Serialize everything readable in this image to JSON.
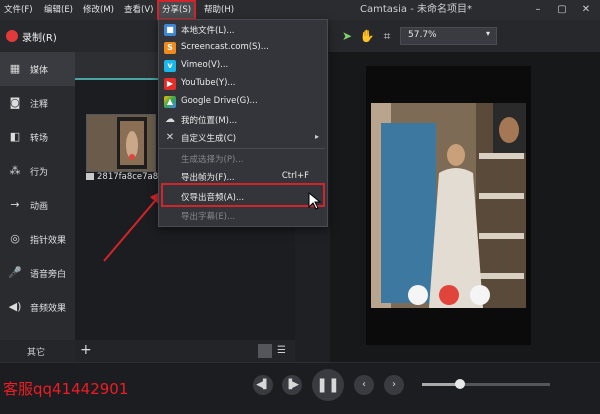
{
  "menubar": {
    "items": [
      "文件(F)",
      "编辑(E)",
      "修改(M)",
      "查看(V)",
      "分享(S)",
      "帮助(H)"
    ],
    "title": "Camtasia - 未命名项目*"
  },
  "toolbar": {
    "record_label": "录制(R)",
    "zoom_value": "57.7%"
  },
  "sidebar": {
    "items": [
      {
        "label": "媒体",
        "icon": "film-icon"
      },
      {
        "label": "注释",
        "icon": "annotation-icon"
      },
      {
        "label": "转场",
        "icon": "transition-icon"
      },
      {
        "label": "行为",
        "icon": "behavior-icon"
      },
      {
        "label": "动画",
        "icon": "animation-icon"
      },
      {
        "label": "指针效果",
        "icon": "cursor-effect-icon"
      },
      {
        "label": "语音旁白",
        "icon": "microphone-icon"
      },
      {
        "label": "音频效果",
        "icon": "speaker-icon"
      }
    ],
    "more_label": "其它"
  },
  "bin": {
    "clip_name": "2817fa8ce7a8(",
    "add_label": "+"
  },
  "share_menu": {
    "items": [
      {
        "label": "本地文件(L)...",
        "icon": "local-file-icon",
        "color": "#3f86d4",
        "disabled": false
      },
      {
        "label": "Screencast.com(S)...",
        "icon": "screencast-icon",
        "color": "#f08a1c",
        "disabled": false
      },
      {
        "label": "Vimeo(V)...",
        "icon": "vimeo-icon",
        "color": "#1ab7ea",
        "disabled": false
      },
      {
        "label": "YouTube(Y)...",
        "icon": "youtube-icon",
        "color": "#e52d27",
        "disabled": false
      },
      {
        "label": "Google Drive(G)...",
        "icon": "google-drive-icon",
        "color": "#34a853",
        "disabled": false
      },
      {
        "label": "我的位置(M)...",
        "icon": "cloud-icon",
        "color": "#9aa0a8",
        "disabled": false
      },
      {
        "label": "自定义生成(C)",
        "icon": "tools-icon",
        "color": "#c9c9c9",
        "disabled": false,
        "submenu": true
      },
      {
        "label": "生成选择为(P)...",
        "disabled": true
      },
      {
        "label": "导出帧为(F)...",
        "shortcut": "Ctrl+F",
        "disabled": false
      },
      {
        "label": "仅导出音频(A)...",
        "disabled": false
      },
      {
        "label": "导出字幕(E)...",
        "disabled": true
      }
    ]
  },
  "watermark": "客服qq41442901",
  "colors": {
    "highlight_red": "#d2252b",
    "accent_teal": "#4aa3a3",
    "record_red": "#e23a3a"
  }
}
